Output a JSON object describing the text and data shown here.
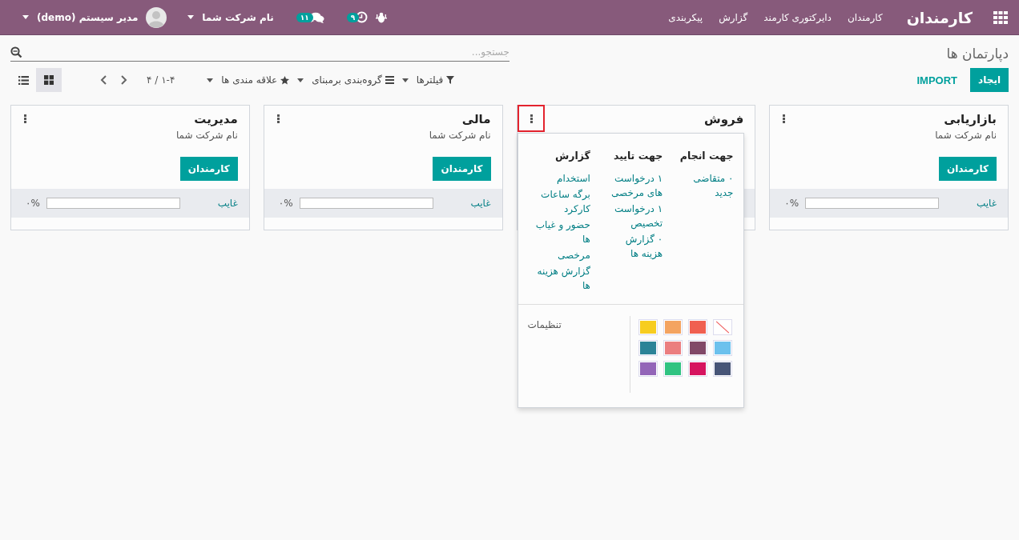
{
  "topbar": {
    "brand": "کارمندان",
    "menu": [
      "کارمندان",
      "دایرکتوری کارمند",
      "گزارش",
      "پیکربندی"
    ],
    "activity_badge": "۹",
    "messages_badge": "۱۱",
    "company": "نام شرکت شما",
    "user": "مدیر سیستم (demo)"
  },
  "breadcrumb": "دپارتمان ها",
  "search": {
    "placeholder": "جستجو..."
  },
  "buttons": {
    "create": "ایجاد",
    "import": "IMPORT"
  },
  "filters": [
    {
      "kind": "filter",
      "label": "فیلترها"
    },
    {
      "kind": "group",
      "label": "گروه‌بندی برمبنای"
    },
    {
      "kind": "favorite",
      "label": "علاقه مندی ها"
    }
  ],
  "pager": "۱-۴ / ۴",
  "views": [
    {
      "kind": "kanban",
      "selected": true
    },
    {
      "kind": "list",
      "selected": false
    }
  ],
  "cards": [
    {
      "title": "بازاریابی",
      "company": "نام شرکت شما",
      "button": "کارمندان",
      "absent": "غایب",
      "level": 0,
      "percent": "۰%",
      "highlighted": false,
      "menu_open": false
    },
    {
      "title": "فروش",
      "highlighted": true,
      "menu_open": true
    },
    {
      "title": "مالی",
      "company": "نام شرکت شما",
      "button": "کارمندان",
      "absent": "غایب",
      "level": 0,
      "percent": "۰%",
      "highlighted": false,
      "menu_open": false
    },
    {
      "title": "مدیریت",
      "company": "نام شرکت شما",
      "button": "کارمندان",
      "absent": "غایب",
      "level": 0,
      "percent": "۰%",
      "highlighted": false,
      "menu_open": false
    }
  ],
  "card_menu": {
    "columns": [
      {
        "title": "جهت انجام",
        "items": [
          "۰ متقاضی جدید"
        ]
      },
      {
        "title": "جهت تایید",
        "items": [
          "۱ درخواست های مرخصی",
          "۱ درخواست تخصیص",
          "۰ گزارش هزینه ها"
        ]
      },
      {
        "title": "گزارش",
        "items": [
          "استخدام",
          "برگه ساعات کارکرد",
          "حضور و غیاب ها",
          "مرخصی",
          "گزارش هزینه ها"
        ]
      }
    ],
    "colors": [
      {
        "kind": "none"
      },
      {
        "kind": "color",
        "color": "#f06050"
      },
      {
        "kind": "color",
        "color": "#f4a460"
      },
      {
        "kind": "color",
        "color": "#f7cd1f"
      },
      {
        "kind": "color",
        "color": "#6cc1ed"
      },
      {
        "kind": "color",
        "color": "#814968"
      },
      {
        "kind": "color",
        "color": "#eb7e7f"
      },
      {
        "kind": "color",
        "color": "#2c8397"
      },
      {
        "kind": "color",
        "color": "#475577"
      },
      {
        "kind": "color",
        "color": "#d6145f"
      },
      {
        "kind": "color",
        "color": "#30c381"
      },
      {
        "kind": "color",
        "color": "#9365b8"
      }
    ],
    "settings": "تنظیمات"
  }
}
